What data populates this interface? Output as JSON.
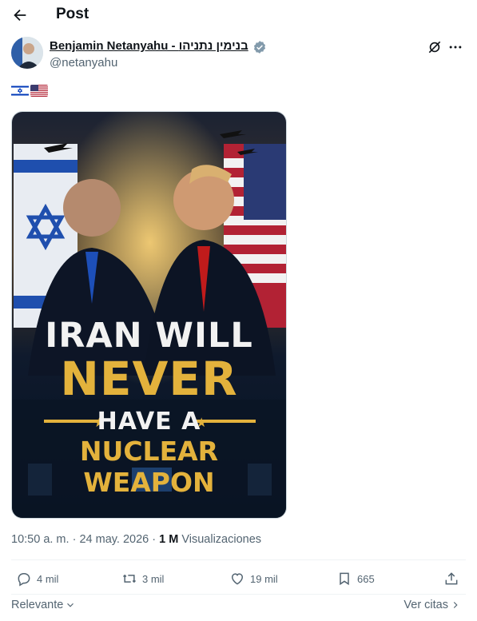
{
  "header": {
    "back_icon": "arrow-left-icon",
    "title": "Post"
  },
  "author": {
    "name": "Benjamin Netanyahu - בנימין נתניהו",
    "handle": "@netanyahu",
    "verified_icon": "verified-badge-icon",
    "verified_color": "#829aab"
  },
  "post": {
    "flags": [
      "israel-flag",
      "us-flag"
    ],
    "image": {
      "lines": [
        "IRAN WILL",
        "NEVER",
        "HAVE A",
        "NUCLEAR WEAPON"
      ]
    }
  },
  "meta": {
    "time": "10:50 a. m.",
    "separator": "·",
    "date": "24 may. 2026",
    "views_count": "1 M",
    "views_label": "Visualizaciones"
  },
  "actions": {
    "replies": "4 mil",
    "reposts": "3 mil",
    "likes": "19 mil",
    "bookmarks": "665"
  },
  "footer": {
    "sort_label": "Relevante",
    "quotes_label": "Ver citas"
  },
  "colors": {
    "text": "#0f1419",
    "muted": "#536471",
    "gold": "#e3b23c",
    "navy": "#0e1a2e"
  }
}
